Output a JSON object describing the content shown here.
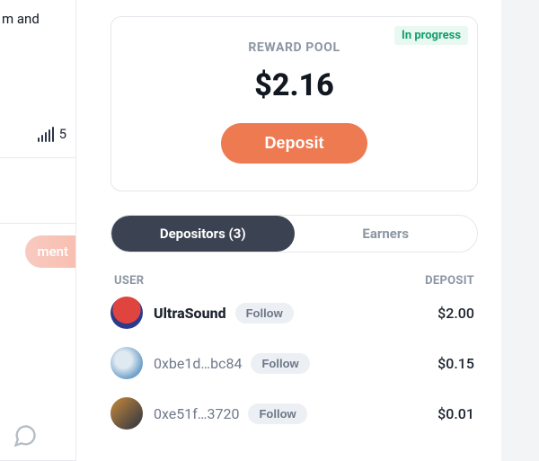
{
  "left": {
    "snippet": "m and",
    "signal_value": "5",
    "pill_text": "ment"
  },
  "pool": {
    "label": "REWARD POOL",
    "status": "In progress",
    "amount": "$2.16",
    "deposit_button": "Deposit"
  },
  "tabs": {
    "depositors": "Depositors (3)",
    "earners": "Earners"
  },
  "table": {
    "header_user": "USER",
    "header_deposit": "DEPOSIT",
    "follow_label": "Follow",
    "rows": [
      {
        "name": "UltraSound",
        "bold": true,
        "amount": "$2.00"
      },
      {
        "name": "0xbe1d…bc84",
        "bold": false,
        "amount": "$0.15"
      },
      {
        "name": "0xe51f…3720",
        "bold": false,
        "amount": "$0.01"
      }
    ]
  }
}
